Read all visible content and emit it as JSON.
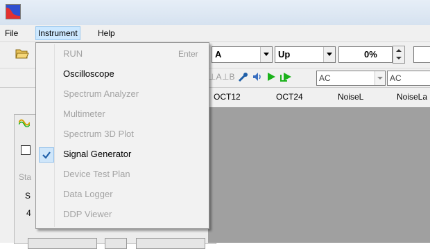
{
  "menubar": {
    "items": [
      {
        "label": "File"
      },
      {
        "label": "Instrument"
      },
      {
        "label": "Help"
      }
    ]
  },
  "toolbar": {
    "channel_value": "A",
    "slope_value": "Up",
    "percent_value": "0%"
  },
  "coupling": {
    "a_value": "AC",
    "b_value": "AC"
  },
  "tb2_labels": {
    "a_marker": "A",
    "b_marker": "B"
  },
  "columns": [
    "OCT12",
    "OCT24",
    "NoiseL",
    "NoiseLa"
  ],
  "left_stubs": {
    "sta": "Sta",
    "s": "S",
    "four": "4"
  },
  "instrument_menu": {
    "items": [
      {
        "label": "RUN",
        "shortcut": "Enter",
        "enabled": false,
        "checked": false
      },
      {
        "label": "Oscilloscope",
        "shortcut": "",
        "enabled": true,
        "checked": false
      },
      {
        "label": "Spectrum Analyzer",
        "shortcut": "",
        "enabled": false,
        "checked": false
      },
      {
        "label": "Multimeter",
        "shortcut": "",
        "enabled": false,
        "checked": false
      },
      {
        "label": "Spectrum 3D Plot",
        "shortcut": "",
        "enabled": false,
        "checked": false
      },
      {
        "label": "Signal Generator",
        "shortcut": "",
        "enabled": true,
        "checked": true
      },
      {
        "label": "Device Test Plan",
        "shortcut": "",
        "enabled": false,
        "checked": false
      },
      {
        "label": "Data Logger",
        "shortcut": "",
        "enabled": false,
        "checked": false
      },
      {
        "label": "DDP Viewer",
        "shortcut": "",
        "enabled": false,
        "checked": false
      }
    ]
  },
  "colors": {
    "menu_highlight": "#cce8ff",
    "check_blue": "#1f5fa8",
    "play_green": "#1bb21b",
    "workspace_grey": "#a0a0a0"
  }
}
